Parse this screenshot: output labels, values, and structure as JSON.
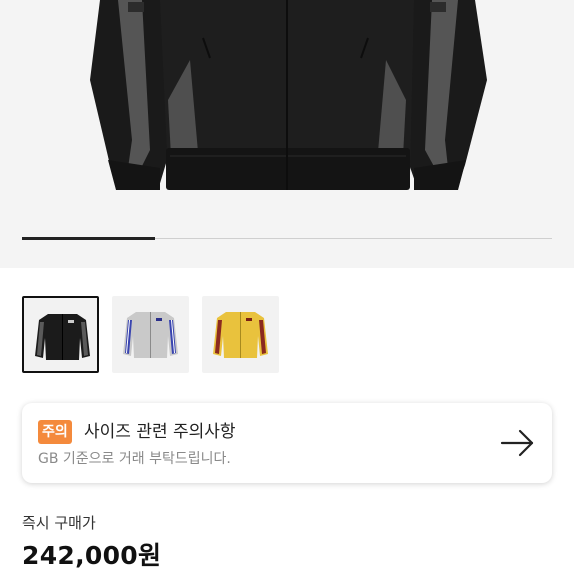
{
  "product": {
    "carousel_progress": 0.25,
    "thumbnails": [
      {
        "name": "black-track-jacket",
        "color": "#1b1b1b",
        "stripe": "#5a5a5a",
        "selected": true
      },
      {
        "name": "grey-track-jacket",
        "color": "#c9c9c9",
        "stripe": "#3a45b0",
        "selected": false
      },
      {
        "name": "yellow-track-jacket",
        "color": "#e9c23d",
        "stripe": "#8b2a1f",
        "selected": false
      }
    ]
  },
  "notice": {
    "badge": "주의",
    "title": "사이즈 관련 주의사항",
    "description": "GB 기준으로 거래 부탁드립니다.",
    "icon": "arrow-right-icon"
  },
  "purchase": {
    "label": "즉시 구매가",
    "price": "242,000원"
  }
}
